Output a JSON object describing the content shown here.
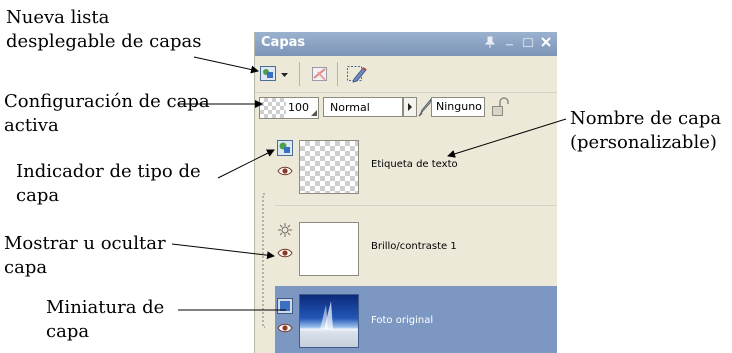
{
  "callouts": {
    "new_layer_dropdown": [
      "Nueva lista",
      "desplegable de capas"
    ],
    "active_layer_settings": [
      "Configuración de capa",
      "activa"
    ],
    "layer_type_indicator": [
      "Indicador de tipo de",
      "capa"
    ],
    "show_hide_layer": [
      "Mostrar u ocultar",
      "capa"
    ],
    "layer_thumbnail": [
      "Miniatura de",
      "capa"
    ],
    "layer_name": [
      "Nombre de capa",
      "(personalizable)"
    ]
  },
  "palette": {
    "title": "Capas",
    "titlebar_icons": [
      "pin-icon",
      "minimize-icon",
      "maximize-icon",
      "close-icon"
    ],
    "toolbar": [
      "new-layer-icon",
      "dropdown-arrow-icon",
      "delete-layer-icon",
      "layer-properties-icon"
    ],
    "opacity": "100",
    "blend_mode": "Normal",
    "brush_variance": "Ninguno",
    "layers": [
      {
        "name": "Etiqueta de texto",
        "type": "vector",
        "visible": true,
        "selected": false
      },
      {
        "name": "Brillo/contraste 1",
        "type": "adjustment",
        "visible": true,
        "selected": false
      },
      {
        "name": "Foto original",
        "type": "raster",
        "visible": true,
        "selected": true
      }
    ]
  },
  "colors": {
    "titlebar": "#8aa2c4",
    "selected_row": "#7b97c2",
    "panel_bg": "#ece9d8"
  }
}
